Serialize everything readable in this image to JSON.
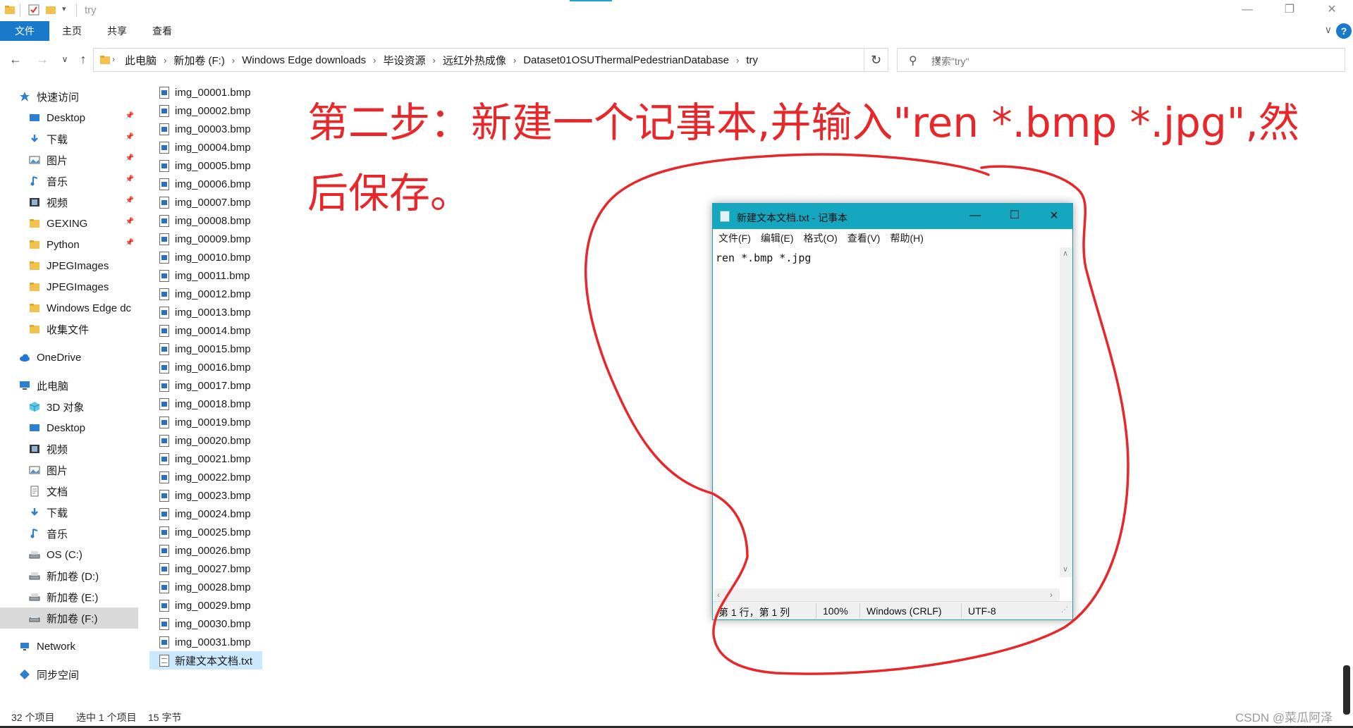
{
  "window": {
    "title": "try",
    "minimize": "—",
    "restore": "❐",
    "close": "✕"
  },
  "ribbon": {
    "tabs": [
      "文件",
      "主页",
      "共享",
      "查看"
    ],
    "help": "?",
    "expand": "∨",
    "accent": "#1979ca"
  },
  "address": {
    "crumbs": [
      "此电脑",
      "新加卷 (F:)",
      "Windows Edge downloads",
      "毕设资源",
      "远红外热成像",
      "Dataset01OSUThermalPedestrianDatabase",
      "try"
    ],
    "search_placeholder": "搜索\"try\""
  },
  "sidebar": {
    "items": [
      {
        "label": "快速访问",
        "icon": "star-icon",
        "pinned": false
      },
      {
        "label": "Desktop",
        "icon": "desktop-icon",
        "pinned": true
      },
      {
        "label": "下载",
        "icon": "download-icon",
        "pinned": true
      },
      {
        "label": "图片",
        "icon": "pictures-icon",
        "pinned": true
      },
      {
        "label": "音乐",
        "icon": "music-icon",
        "pinned": true
      },
      {
        "label": "视频",
        "icon": "video-icon",
        "pinned": true
      },
      {
        "label": "GEXING",
        "icon": "folder-icon",
        "pinned": true
      },
      {
        "label": "Python",
        "icon": "folder-icon",
        "pinned": true
      },
      {
        "label": "JPEGImages",
        "icon": "folder-icon",
        "pinned": false
      },
      {
        "label": "JPEGImages",
        "icon": "folder-icon",
        "pinned": false
      },
      {
        "label": "Windows Edge dc",
        "icon": "folder-icon",
        "pinned": false
      },
      {
        "label": "收集文件",
        "icon": "folder-icon",
        "pinned": false
      },
      {
        "label": "OneDrive",
        "icon": "cloud-icon",
        "pinned": false
      },
      {
        "label": "此电脑",
        "icon": "computer-icon",
        "pinned": false
      },
      {
        "label": "3D 对象",
        "icon": "cube-icon",
        "pinned": false
      },
      {
        "label": "Desktop",
        "icon": "desktop-icon",
        "pinned": false
      },
      {
        "label": "视频",
        "icon": "video-icon",
        "pinned": false
      },
      {
        "label": "图片",
        "icon": "pictures-icon",
        "pinned": false
      },
      {
        "label": "文档",
        "icon": "document-icon",
        "pinned": false
      },
      {
        "label": "下载",
        "icon": "download-icon",
        "pinned": false
      },
      {
        "label": "音乐",
        "icon": "music-icon",
        "pinned": false
      },
      {
        "label": "OS (C:)",
        "icon": "drive-icon",
        "pinned": false
      },
      {
        "label": "新加卷 (D:)",
        "icon": "drive-icon",
        "pinned": false
      },
      {
        "label": "新加卷 (E:)",
        "icon": "drive-icon",
        "pinned": false
      },
      {
        "label": "新加卷 (F:)",
        "icon": "drive-icon",
        "pinned": false,
        "selected": true
      },
      {
        "label": "Network",
        "icon": "network-icon",
        "pinned": false
      },
      {
        "label": "同步空间",
        "icon": "sync-icon",
        "pinned": false
      }
    ]
  },
  "files": [
    "img_00001.bmp",
    "img_00002.bmp",
    "img_00003.bmp",
    "img_00004.bmp",
    "img_00005.bmp",
    "img_00006.bmp",
    "img_00007.bmp",
    "img_00008.bmp",
    "img_00009.bmp",
    "img_00010.bmp",
    "img_00011.bmp",
    "img_00012.bmp",
    "img_00013.bmp",
    "img_00014.bmp",
    "img_00015.bmp",
    "img_00016.bmp",
    "img_00017.bmp",
    "img_00018.bmp",
    "img_00019.bmp",
    "img_00020.bmp",
    "img_00021.bmp",
    "img_00022.bmp",
    "img_00023.bmp",
    "img_00024.bmp",
    "img_00025.bmp",
    "img_00026.bmp",
    "img_00027.bmp",
    "img_00028.bmp",
    "img_00029.bmp",
    "img_00030.bmp",
    "img_00031.bmp",
    "新建文本文档.txt"
  ],
  "status": {
    "count": "32 个项目",
    "selected": "选中 1 个项目",
    "size": "15 字节"
  },
  "annotation": {
    "line1": "第二步：新建一个记事本,并输入\"ren *.bmp *.jpg\",然",
    "line2": "后保存。",
    "color": "#e8272a"
  },
  "notepad": {
    "title": "新建文本文档.txt - 记事本",
    "menu": [
      "文件(F)",
      "编辑(E)",
      "格式(O)",
      "查看(V)",
      "帮助(H)"
    ],
    "content": "ren *.bmp *.jpg",
    "status": {
      "position": "第 1 行，第 1 列",
      "zoom": "100%",
      "line_ending": "Windows (CRLF)",
      "encoding": "UTF-8"
    },
    "title_color": "#14a7bf"
  },
  "watermark": "CSDN @菜瓜阿泽"
}
